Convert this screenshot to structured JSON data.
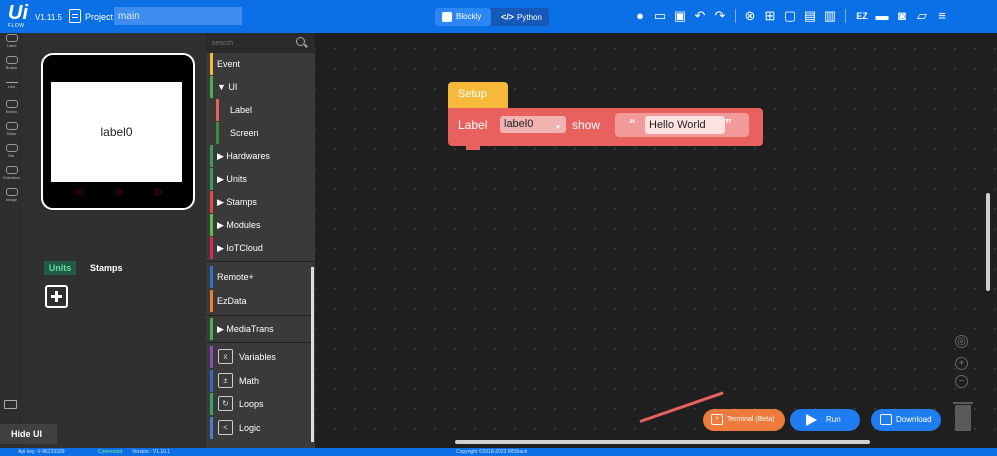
{
  "app": {
    "logo": "Ui",
    "logo_sub": "FLOW",
    "version": "V1.11.5",
    "project_label": "Project",
    "project_name": "main"
  },
  "mode": {
    "blockly": "Blockly",
    "python_tag": "</>",
    "python": "Python"
  },
  "toolbar_icons": [
    "user-icon",
    "keyboard-icon",
    "screen-icon",
    "undo-icon",
    "redo-icon",
    "connect-icon",
    "new-file-icon",
    "open-folder-icon",
    "save-icon",
    "save-as-icon",
    "ezdata-icon",
    "remote-icon",
    "code-icon",
    "comment-icon",
    "menu-icon"
  ],
  "left_tools": [
    "Label",
    "Button",
    "Line",
    "Switch",
    "Slider",
    "Bar",
    "Checkbox",
    "Image"
  ],
  "preview": {
    "screen_label": "label0",
    "units_tab": "Units",
    "stamps_tab": "Stamps",
    "hide_ui": "Hide UI"
  },
  "categories": {
    "search_placeholder": "search",
    "items": [
      {
        "label": "Event",
        "color": "#f7b93a"
      },
      {
        "label": "▼ UI",
        "color": "#4caf50"
      },
      {
        "label": "Label",
        "color": "#e8615f"
      },
      {
        "label": "Screen",
        "color": "#3b8f3b"
      },
      {
        "label": "▶ Hardwares",
        "color": "#3b9c5a"
      },
      {
        "label": "▶ Units",
        "color": "#3b9c5a"
      },
      {
        "label": "▶ Stamps",
        "color": "#e84a3c"
      },
      {
        "label": "▶ Modules",
        "color": "#5bbf4c"
      },
      {
        "label": "▶ IoTCloud",
        "color": "#e02a55"
      },
      {
        "label": "Remote+",
        "color": "#2e6fd6"
      },
      {
        "label": "EzData",
        "color": "#f07a3a"
      },
      {
        "label": "▶ MediaTrans",
        "color": "#4caf50"
      },
      {
        "label": "Variables",
        "color": "#8e4bc2"
      },
      {
        "label": "Math",
        "color": "#3b67c9"
      },
      {
        "label": "Loops",
        "color": "#38a36a"
      },
      {
        "label": "Logic",
        "color": "#4a7bd6"
      }
    ]
  },
  "workspace": {
    "setup_label": "Setup",
    "block_label": "Label",
    "block_target": "label0",
    "block_action": "show",
    "block_string": "Hello World",
    "quote_open": "“",
    "quote_close": "”"
  },
  "buttons": {
    "terminal": "Terminal (Beta)",
    "run": "Run",
    "download": "Download"
  },
  "status": {
    "api_key": "Api key: ⚲ 86233339",
    "connected": "Connected",
    "version": "Version : V1.10.1",
    "copyright": "Copyright ©2018-2023 M5Stack"
  }
}
